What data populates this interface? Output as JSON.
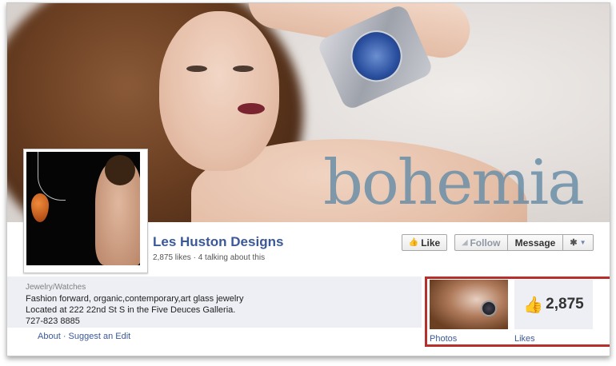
{
  "cover": {
    "logo_text": "bohemia"
  },
  "page": {
    "name": "Les Huston Designs",
    "stats": "2,875 likes · 4 talking about this"
  },
  "buttons": {
    "like": "Like",
    "follow": "Follow",
    "message": "Message"
  },
  "about": {
    "category": "Jewelry/Watches",
    "lines": [
      "Fashion forward, organic,contemporary,art glass jewelry",
      "Located at 222 22nd St S in the Five Deuces Galleria.",
      "727-823 8885"
    ],
    "links": {
      "about": "About",
      "separator": "·",
      "suggest": "Suggest an Edit"
    }
  },
  "apps": {
    "photos_label": "Photos",
    "likes_label": "Likes",
    "likes_count": "2,875"
  },
  "colors": {
    "brand": "#3b5998",
    "highlight": "#b72f2a"
  }
}
